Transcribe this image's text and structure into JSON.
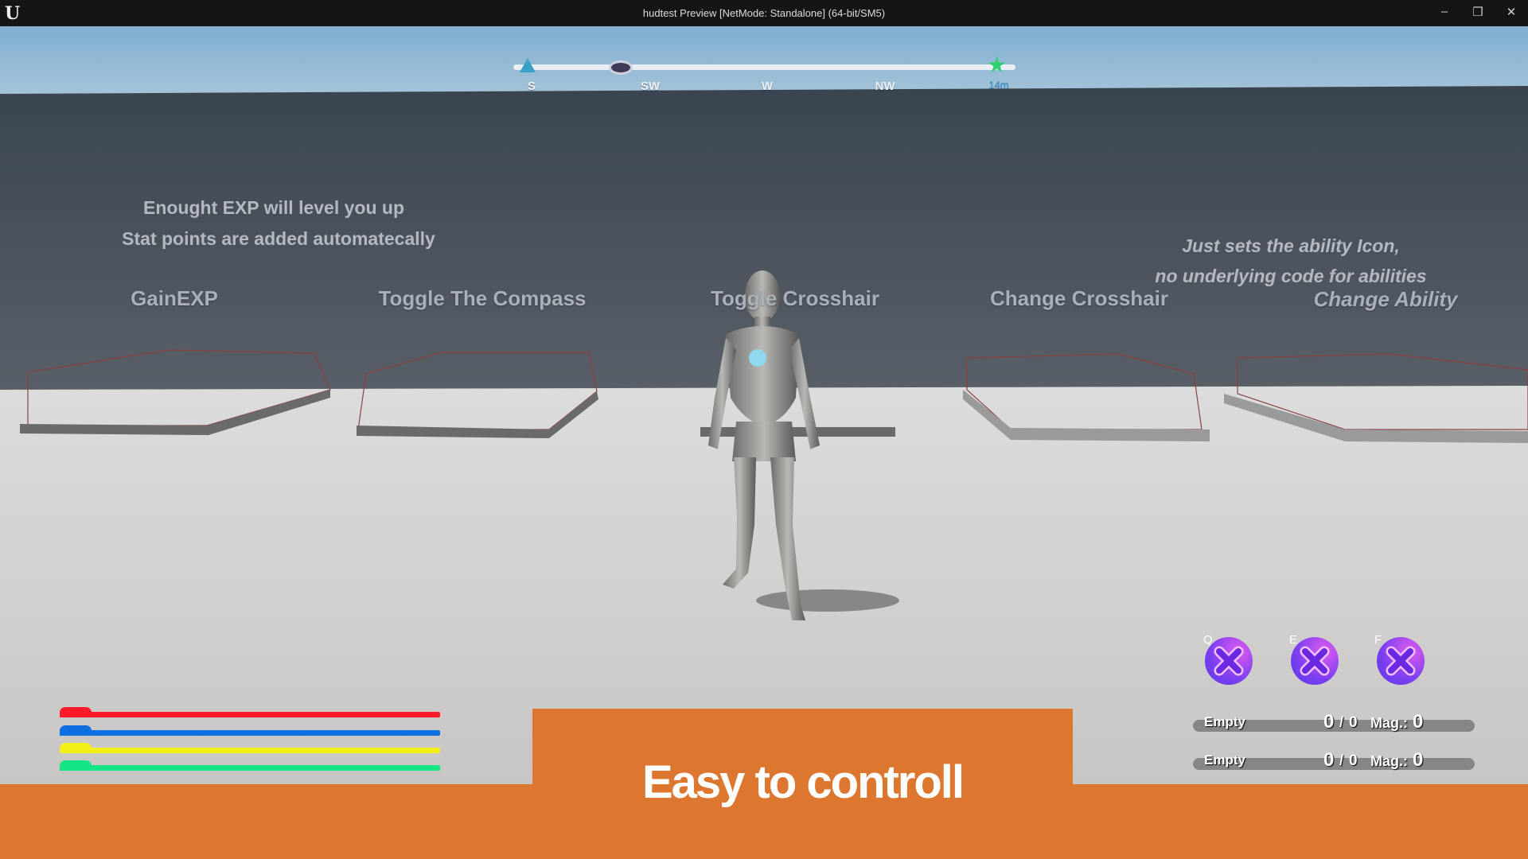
{
  "window": {
    "title": "hudtest Preview [NetMode: Standalone]  (64-bit/SM5)",
    "logo": "U"
  },
  "compass": {
    "labels": [
      "S",
      "SW",
      "W",
      "NW"
    ],
    "marker_distance": "14m",
    "icons": [
      "objective-triangle-icon",
      "eye-icon",
      "star-icon"
    ]
  },
  "notes": {
    "exp_line1": "Enought EXP will level you up",
    "exp_line2": "Stat points are added automatecally",
    "ability_line1": "Just sets the ability Icon,",
    "ability_line2": "no underlying code for abilities"
  },
  "signs": [
    "GainEXP",
    "Toggle The Compass",
    "Toggle Crosshair",
    "Change Crosshair",
    "Change Ability"
  ],
  "stat_bars": [
    {
      "color": "#ff1a2a"
    },
    {
      "color": "#0d6fe0"
    },
    {
      "color": "#f3ee18"
    },
    {
      "color": "#14e686"
    }
  ],
  "abilities": [
    {
      "key": "Q",
      "icon": "x-icon"
    },
    {
      "key": "E",
      "icon": "x-icon"
    },
    {
      "key": "F",
      "icon": "x-icon"
    }
  ],
  "weapons": [
    {
      "name": "Empty",
      "ammo": "0",
      "reserve": "0",
      "mag_label": "Mag.:",
      "mag": "0"
    },
    {
      "name": "Empty",
      "ammo": "0",
      "reserve": "0",
      "mag_label": "Mag.:",
      "mag": "0"
    }
  ],
  "banner": {
    "text": "Easy to controll",
    "color": "#dd772f"
  }
}
